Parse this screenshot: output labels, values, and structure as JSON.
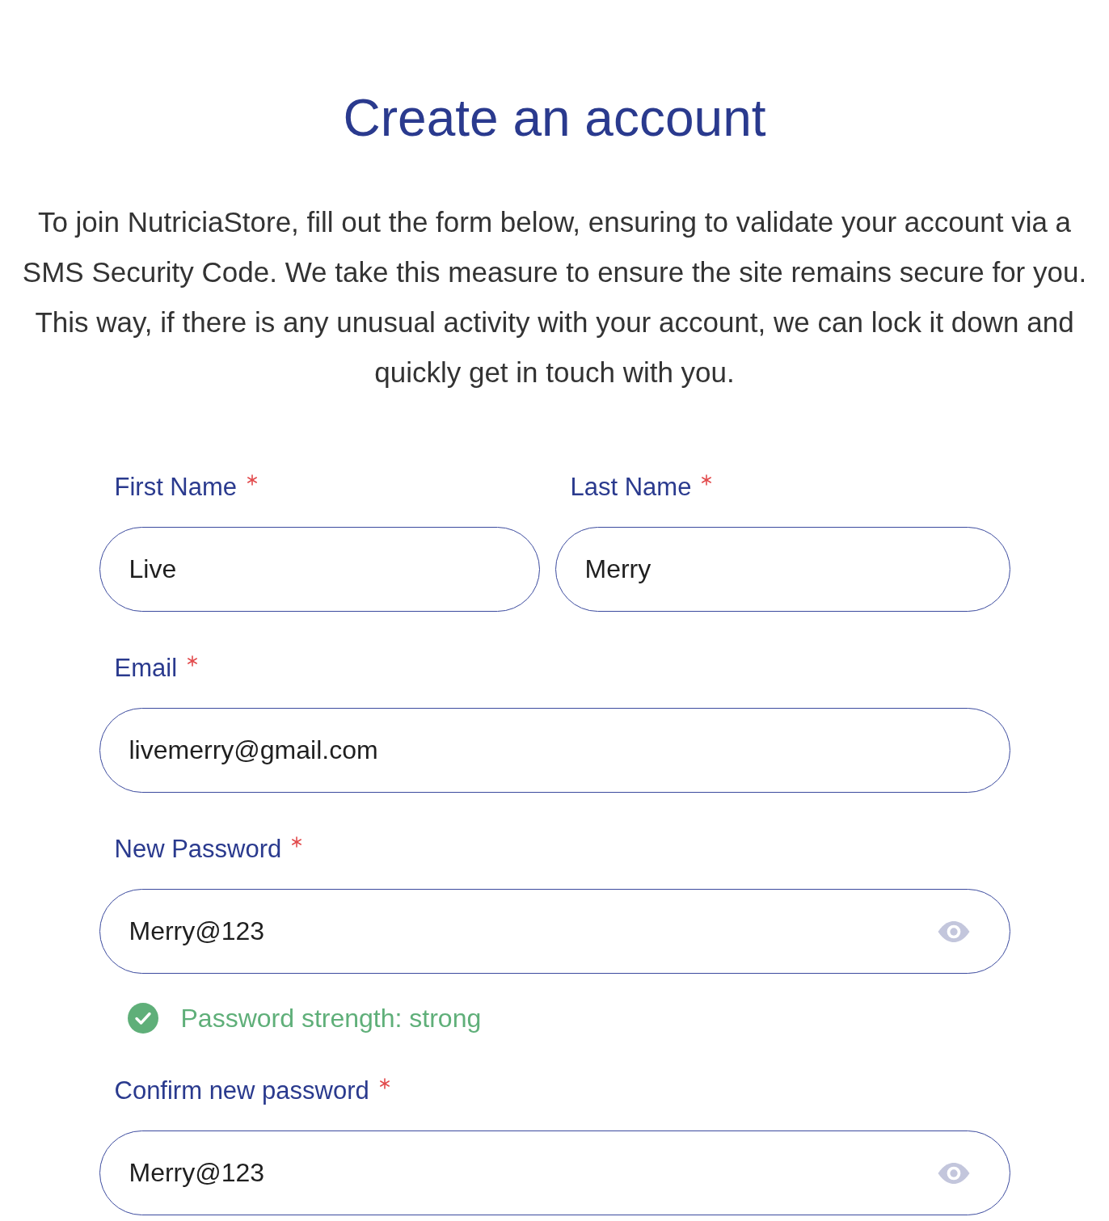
{
  "title": "Create an account",
  "intro": "To join NutriciaStore, fill out the form below, ensuring to validate your account via a SMS Security Code. We take this measure to ensure the site remains secure for you. This way, if there is any unusual activity with your account, we can lock it down and quickly get in touch with you.",
  "rows": [
    {
      "fields": [
        {
          "label": "First Name",
          "required": true,
          "kind": "text",
          "value": "Live"
        },
        {
          "label": "Last Name",
          "required": true,
          "kind": "text",
          "value": "Merry"
        }
      ]
    },
    {
      "fields": [
        {
          "label": "Email",
          "required": true,
          "kind": "text",
          "value": "livemerry@gmail.com"
        }
      ]
    },
    {
      "fields": [
        {
          "label": "New Password",
          "required": true,
          "kind": "password",
          "value": "Merry@123",
          "hint": {
            "text": "Password strength: strong",
            "valid": true
          }
        }
      ]
    },
    {
      "fields": [
        {
          "label": "Confirm new password",
          "required": true,
          "kind": "password",
          "value": "Merry@123"
        }
      ]
    }
  ]
}
